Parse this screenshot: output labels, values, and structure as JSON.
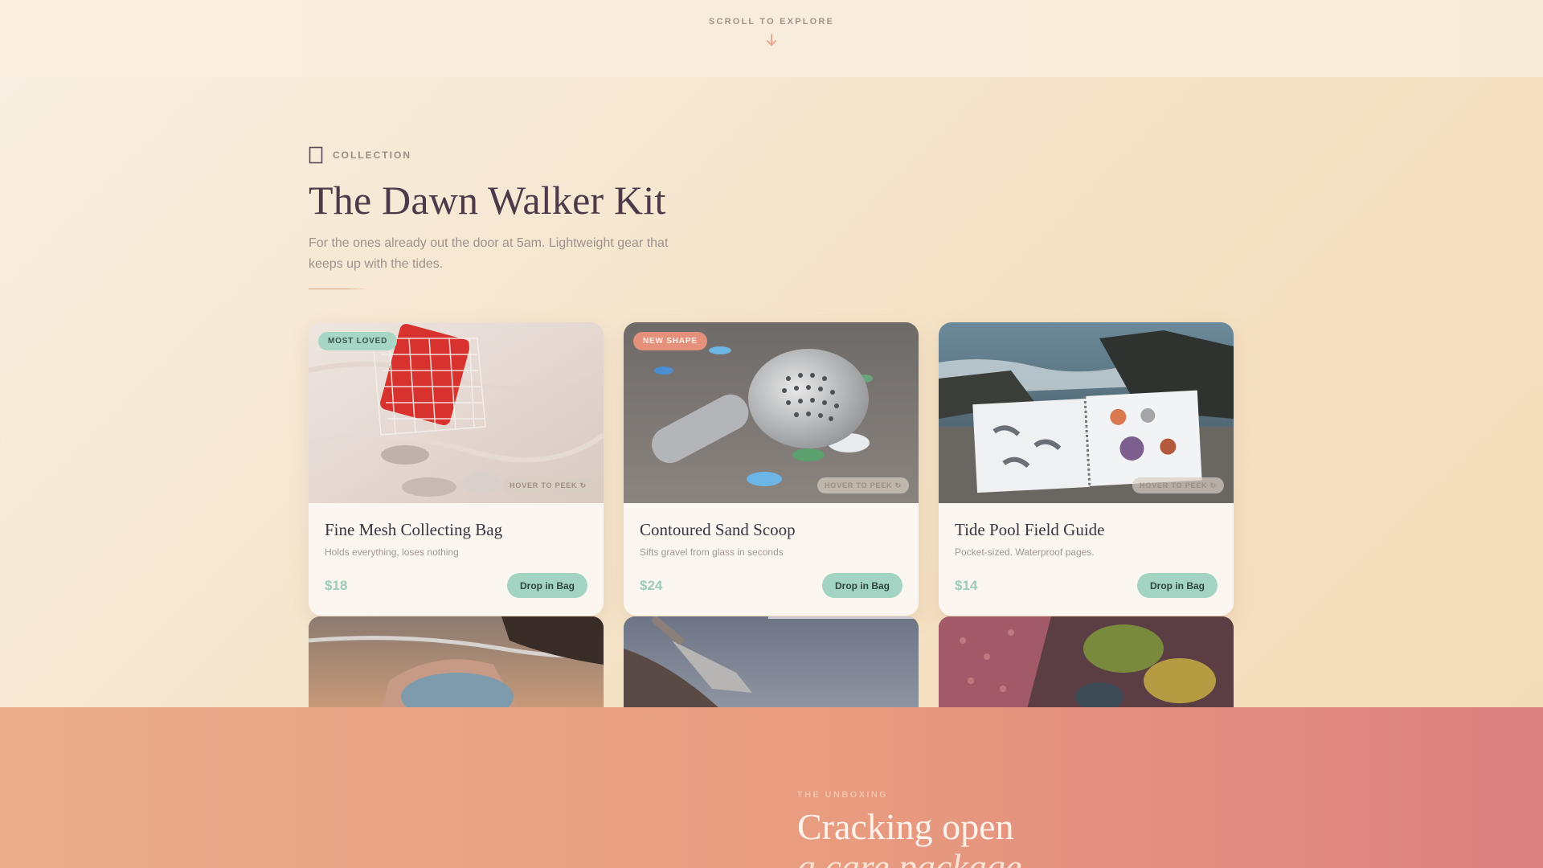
{
  "scroll": {
    "label": "SCROLL TO EXPLORE"
  },
  "collection": {
    "eyebrow": "COLLECTION",
    "title": "The Dawn Walker Kit",
    "subtitle": "For the ones already out the door at 5am. Lightweight gear that keeps up with the tides."
  },
  "products": [
    {
      "badge": "MOST LOVED",
      "badge_style": "mint",
      "peek": "HOVER TO PEEK ↻",
      "title": "Fine Mesh Collecting Bag",
      "desc": "Holds everything, loses nothing",
      "price": "$18",
      "cta": "Drop in Bag"
    },
    {
      "badge": "NEW SHAPE",
      "badge_style": "coral",
      "peek": "HOVER TO PEEK ↻",
      "title": "Contoured Sand Scoop",
      "desc": "Sifts gravel from glass in seconds",
      "price": "$24",
      "cta": "Drop in Bag"
    },
    {
      "badge": "",
      "badge_style": "",
      "peek": "HOVER TO PEEK ↻",
      "title": "Tide Pool Field Guide",
      "desc": "Pocket-sized. Waterproof pages.",
      "price": "$14",
      "cta": "Drop in Bag"
    }
  ],
  "unboxing": {
    "eyebrow": "THE UNBOXING",
    "title_line1": "Cracking open",
    "title_line2": "a care package"
  },
  "colors": {
    "accent_mint": "#a3d3c2",
    "accent_coral": "#e4907a",
    "title_plum": "#4c3a48"
  }
}
